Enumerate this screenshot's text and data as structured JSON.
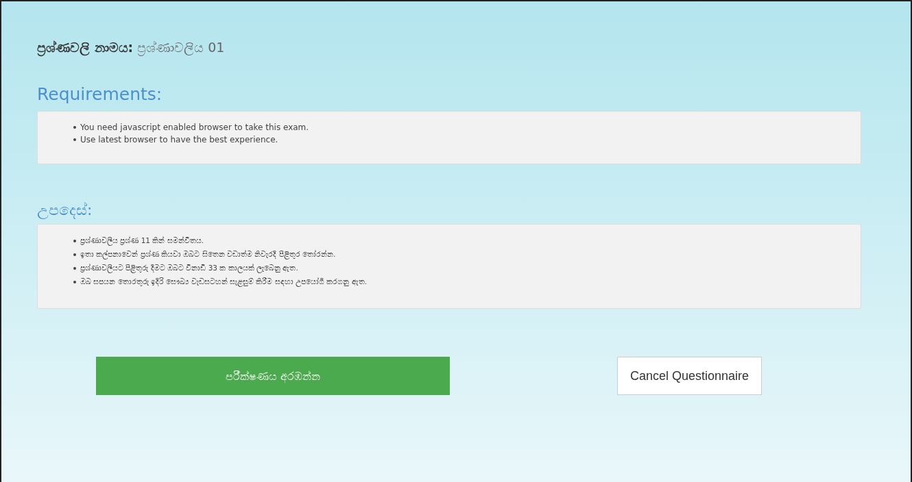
{
  "questionnaire": {
    "label": "ප්‍රශ්ණවලි නාමය:",
    "name": "ප්‍රශ්ණාවලිය 01"
  },
  "requirements": {
    "heading": "Requirements:",
    "items": [
      "You need javascript enabled browser to take this exam.",
      "Use latest browser to have the best experience."
    ]
  },
  "instructions": {
    "heading": "උපදෙස්:",
    "items": [
      "ප්‍රශ්ණාවලිය ප්‍රශ්ණ 11 කින් සමන්විතය.",
      "ඉතා කල්පනාවෙන් ප්‍රශ්ණ කියවා ඔබට සිතෙන වඩාත්ම නිවැරදි පිළිතුර තෝරන්න.",
      "ප්‍රශ්ණාවලියට පිළිතුරු දීමට ඔබට විනාඩි 33 ක කාලයක් ලැබෙනු ඇත.",
      "ඔබ සපයන තොරතුරු ඉදිරි සෞඛ්‍ය වැඩසටහන් සැළසුම් කිරීම සඳහා උපයෝගී කරගනු ඇත."
    ]
  },
  "buttons": {
    "start": "පරීක්ෂණය අරඹන්න",
    "cancel": "Cancel Questionnaire"
  }
}
